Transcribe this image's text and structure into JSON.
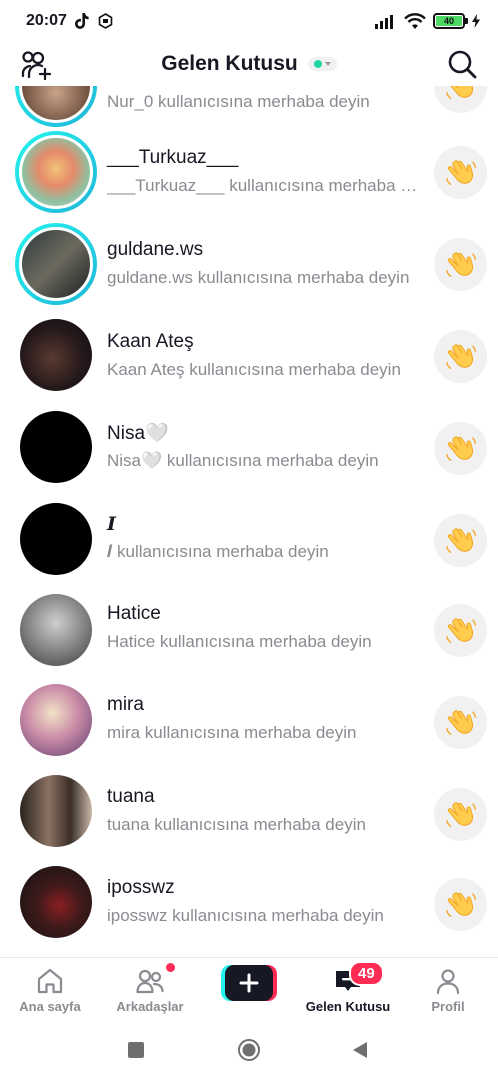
{
  "status_bar": {
    "time": "20:07",
    "battery": "40"
  },
  "header": {
    "title": "Gelen Kutusu",
    "left_icon": "add-friends-icon",
    "right_icon": "search-icon",
    "status_color": "#20d5a4"
  },
  "rows": [
    {
      "name": "",
      "subtitle": "Nur_0 kullanıcısına merhaba deyin",
      "ring": true
    },
    {
      "name": "___Turkuaz___",
      "subtitle": "___Turkuaz___ kullanıcısına merhaba deyin",
      "ring": true
    },
    {
      "name": "guldane.ws",
      "subtitle": "guldane.ws kullanıcısına merhaba deyin",
      "ring": true
    },
    {
      "name": "Kaan Ateş",
      "subtitle": "Kaan Ateş kullanıcısına merhaba deyin",
      "ring": false
    },
    {
      "name": "Nisa🤍",
      "subtitle": "Nisa🤍 kullanıcısına merhaba deyin",
      "ring": false
    },
    {
      "name": "𝑰",
      "subtitle": "𝑰 kullanıcısına merhaba deyin",
      "ring": false
    },
    {
      "name": "Hatice",
      "subtitle": "Hatice kullanıcısına merhaba deyin",
      "ring": false
    },
    {
      "name": "mira",
      "subtitle": "mira kullanıcısına merhaba deyin",
      "ring": false
    },
    {
      "name": "tuana",
      "subtitle": "tuana kullanıcısına merhaba deyin",
      "ring": false
    },
    {
      "name": "iposswz",
      "subtitle": "iposswz kullanıcısına merhaba deyin",
      "ring": false
    }
  ],
  "bottom_nav": {
    "home": "Ana sayfa",
    "friends": "Arkadaşlar",
    "inbox": "Gelen Kutusu",
    "inbox_badge": "49",
    "profile": "Profil",
    "accent": "#fe2c55"
  }
}
